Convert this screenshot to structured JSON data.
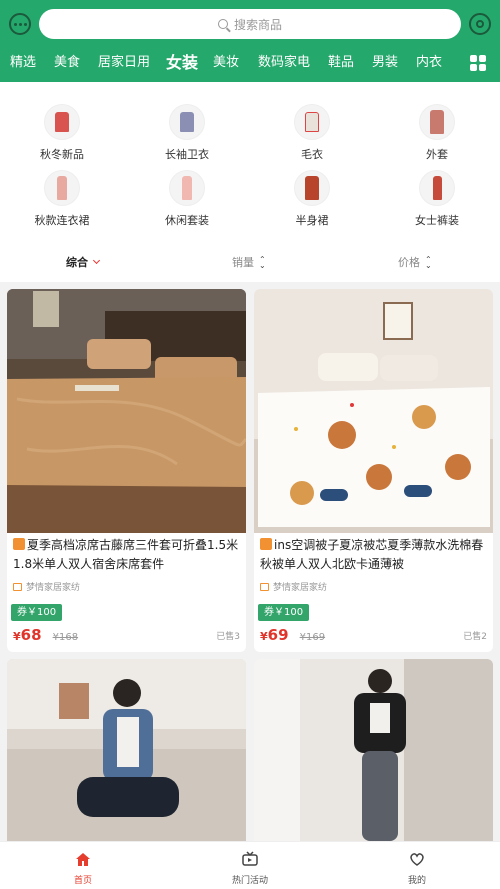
{
  "search": {
    "placeholder": "搜索商品"
  },
  "tabs": [
    "精选",
    "美食",
    "居家日用",
    "女装",
    "美妆",
    "数码家电",
    "鞋品",
    "男装",
    "内衣"
  ],
  "active_tab": "女装",
  "categories": [
    {
      "label": "秋冬新品",
      "icon": "jacket-icon",
      "color": "#d9534f"
    },
    {
      "label": "长袖卫衣",
      "icon": "hoodie-icon",
      "color": "#8a8fb3"
    },
    {
      "label": "毛衣",
      "icon": "sweater-icon",
      "color": "#e8e2da"
    },
    {
      "label": "外套",
      "icon": "coat-icon",
      "color": "#c97a6e"
    },
    {
      "label": "秋款连衣裙",
      "icon": "dress-icon",
      "color": "#e8a9a0"
    },
    {
      "label": "休闲套装",
      "icon": "suit-icon",
      "color": "#f0b8b0"
    },
    {
      "label": "半身裙",
      "icon": "skirt-icon",
      "color": "#b8452b"
    },
    {
      "label": "女士裤装",
      "icon": "pants-icon",
      "color": "#c74b3b"
    }
  ],
  "sort": {
    "comprehensive": "综合",
    "sales": "销量",
    "price": "价格"
  },
  "products": [
    {
      "title": "夏季高档凉席古藤席三件套可折叠1.5米1.8米单人双人宿舍床席套件",
      "shop": "梦情家居家纺",
      "coupon": "券￥100",
      "currency": "¥",
      "price": "68",
      "old_price": "¥168",
      "sold": "已售3"
    },
    {
      "title": "ins空调被子夏凉被芯夏季薄款水洗棉春秋被单人双人北欧卡通薄被",
      "shop": "梦情家居家纺",
      "coupon": "券￥100",
      "currency": "¥",
      "price": "69",
      "old_price": "¥169",
      "sold": "已售2"
    }
  ],
  "nav": {
    "home": "首页",
    "events": "热门活动",
    "mine": "我的"
  },
  "colors": {
    "brand": "#25a86b",
    "price": "#e0352b",
    "coupon": "#33a56b"
  }
}
